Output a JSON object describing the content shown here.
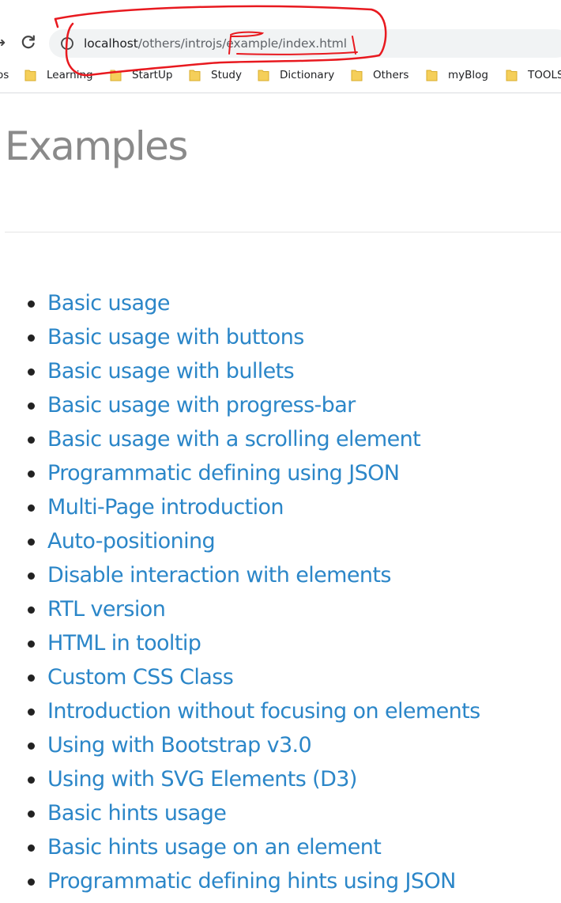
{
  "browser": {
    "url_host": "localhost",
    "url_path": "/others/introjs/example/index.html",
    "annotation_color": "#e8191f",
    "bookmarks": [
      {
        "label": "os"
      },
      {
        "label": "Learning"
      },
      {
        "label": "StartUp"
      },
      {
        "label": "Study"
      },
      {
        "label": "Dictionary"
      },
      {
        "label": "Others"
      },
      {
        "label": "myBlog"
      },
      {
        "label": "TOOLS"
      }
    ]
  },
  "page": {
    "title": "Examples",
    "link_color": "#2b86c8",
    "examples": [
      "Basic usage",
      "Basic usage with buttons",
      "Basic usage with bullets",
      "Basic usage with progress-bar",
      "Basic usage with a scrolling element",
      "Programmatic defining using JSON",
      "Multi-Page introduction",
      "Auto-positioning",
      "Disable interaction with elements",
      "RTL version",
      "HTML in tooltip",
      "Custom CSS Class",
      "Introduction without focusing on elements",
      "Using with Bootstrap v3.0",
      "Using with SVG Elements (D3)",
      "Basic hints usage",
      "Basic hints usage on an element",
      "Programmatic defining hints using JSON"
    ]
  }
}
